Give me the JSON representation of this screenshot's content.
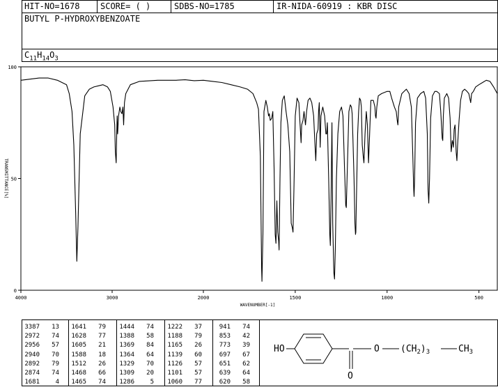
{
  "header": {
    "hit_no": "HIT-NO=1678",
    "score": "SCORE=  (   )",
    "sdbs_no": "SDBS-NO=1785",
    "ir_info": "IR-NIDA-60919 : KBR DISC"
  },
  "compound": {
    "name": "BUTYL P-HYDROXYBENZOATE",
    "formula_parts": [
      {
        "t": "C",
        "sub": false
      },
      {
        "t": "11",
        "sub": true
      },
      {
        "t": "H",
        "sub": false
      },
      {
        "t": "14",
        "sub": true
      },
      {
        "t": "O",
        "sub": false
      },
      {
        "t": "3",
        "sub": true
      }
    ]
  },
  "structure": {
    "ho_label": "HO",
    "o_label": "O",
    "chain_label": "(CH",
    "chain_sub": "2",
    "chain_close": ")",
    "chain_count": "3",
    "end_label": "CH",
    "end_sub": "3",
    "carbonyl_o": "O"
  },
  "chart_data": {
    "type": "line",
    "xlabel": "WAVENUMBER[-1]",
    "ylabel": "TRANSMITTANCE[%]",
    "x_ticks": [
      "4000",
      "3000",
      "2000",
      "1500",
      "1000",
      "500"
    ],
    "x_tick_values": [
      4000,
      3000,
      2000,
      1500,
      1000,
      500
    ],
    "y_ticks": [
      "100",
      "50",
      "0"
    ],
    "y_tick_values": [
      100,
      50,
      0
    ],
    "xlim": [
      4000,
      400
    ],
    "ylim": [
      0,
      100
    ],
    "x_scale": "piecewise (4000-2000 compressed, 2000-400 expanded)",
    "grid": false,
    "series": [
      {
        "values": [
          [
            4000,
            94
          ],
          [
            3900,
            94.5
          ],
          [
            3800,
            95
          ],
          [
            3700,
            95
          ],
          [
            3600,
            94
          ],
          [
            3500,
            92
          ],
          [
            3470,
            88
          ],
          [
            3440,
            80
          ],
          [
            3420,
            65
          ],
          [
            3400,
            35
          ],
          [
            3387,
            13
          ],
          [
            3375,
            28
          ],
          [
            3350,
            70
          ],
          [
            3300,
            87
          ],
          [
            3250,
            90
          ],
          [
            3200,
            91
          ],
          [
            3150,
            91.5
          ],
          [
            3100,
            92
          ],
          [
            3050,
            91
          ],
          [
            3020,
            89
          ],
          [
            2990,
            82
          ],
          [
            2972,
            74
          ],
          [
            2965,
            62
          ],
          [
            2956,
            57
          ],
          [
            2950,
            70
          ],
          [
            2945,
            78
          ],
          [
            2940,
            70
          ],
          [
            2930,
            78
          ],
          [
            2915,
            82
          ],
          [
            2905,
            80
          ],
          [
            2892,
            79
          ],
          [
            2882,
            82
          ],
          [
            2874,
            74
          ],
          [
            2865,
            84
          ],
          [
            2850,
            88
          ],
          [
            2800,
            92
          ],
          [
            2700,
            93.5
          ],
          [
            2500,
            94
          ],
          [
            2300,
            94
          ],
          [
            2200,
            94.2
          ],
          [
            2100,
            93.8
          ],
          [
            2000,
            94
          ],
          [
            1950,
            93.5
          ],
          [
            1900,
            93
          ],
          [
            1850,
            92
          ],
          [
            1800,
            91
          ],
          [
            1760,
            90
          ],
          [
            1730,
            88
          ],
          [
            1710,
            84
          ],
          [
            1700,
            81
          ],
          [
            1690,
            60
          ],
          [
            1683,
            10
          ],
          [
            1681,
            4
          ],
          [
            1676,
            25
          ],
          [
            1670,
            80
          ],
          [
            1660,
            85
          ],
          [
            1652,
            82
          ],
          [
            1645,
            78
          ],
          [
            1641,
            79
          ],
          [
            1636,
            76
          ],
          [
            1628,
            77
          ],
          [
            1622,
            80
          ],
          [
            1615,
            55
          ],
          [
            1609,
            25
          ],
          [
            1605,
            21
          ],
          [
            1600,
            40
          ],
          [
            1595,
            26
          ],
          [
            1590,
            22
          ],
          [
            1588,
            18
          ],
          [
            1583,
            50
          ],
          [
            1578,
            75
          ],
          [
            1570,
            85
          ],
          [
            1560,
            87
          ],
          [
            1550,
            80
          ],
          [
            1540,
            74
          ],
          [
            1530,
            62
          ],
          [
            1522,
            30
          ],
          [
            1516,
            28
          ],
          [
            1512,
            26
          ],
          [
            1507,
            45
          ],
          [
            1500,
            78
          ],
          [
            1490,
            86
          ],
          [
            1480,
            84
          ],
          [
            1475,
            76
          ],
          [
            1468,
            66
          ],
          [
            1465,
            74
          ],
          [
            1458,
            76
          ],
          [
            1452,
            80
          ],
          [
            1444,
            74
          ],
          [
            1438,
            80
          ],
          [
            1430,
            85
          ],
          [
            1420,
            86
          ],
          [
            1410,
            84
          ],
          [
            1400,
            78
          ],
          [
            1393,
            66
          ],
          [
            1388,
            58
          ],
          [
            1383,
            70
          ],
          [
            1376,
            72
          ],
          [
            1373,
            80
          ],
          [
            1369,
            84
          ],
          [
            1366,
            72
          ],
          [
            1364,
            64
          ],
          [
            1360,
            78
          ],
          [
            1350,
            82
          ],
          [
            1340,
            78
          ],
          [
            1333,
            70
          ],
          [
            1329,
            70
          ],
          [
            1325,
            75
          ],
          [
            1318,
            50
          ],
          [
            1312,
            25
          ],
          [
            1309,
            20
          ],
          [
            1305,
            40
          ],
          [
            1300,
            75
          ],
          [
            1296,
            30
          ],
          [
            1290,
            8
          ],
          [
            1286,
            5
          ],
          [
            1282,
            18
          ],
          [
            1276,
            50
          ],
          [
            1268,
            70
          ],
          [
            1258,
            80
          ],
          [
            1248,
            82
          ],
          [
            1240,
            78
          ],
          [
            1232,
            55
          ],
          [
            1225,
            38
          ],
          [
            1222,
            37
          ],
          [
            1218,
            50
          ],
          [
            1208,
            80
          ],
          [
            1200,
            83
          ],
          [
            1194,
            82
          ],
          [
            1190,
            79
          ],
          [
            1186,
            68
          ],
          [
            1180,
            50
          ],
          [
            1175,
            30
          ],
          [
            1172,
            25
          ],
          [
            1170,
            26
          ],
          [
            1168,
            35
          ],
          [
            1160,
            70
          ],
          [
            1155,
            80
          ],
          [
            1150,
            86
          ],
          [
            1144,
            85
          ],
          [
            1140,
            82
          ],
          [
            1135,
            65
          ],
          [
            1130,
            60
          ],
          [
            1126,
            57
          ],
          [
            1120,
            70
          ],
          [
            1113,
            80
          ],
          [
            1107,
            74
          ],
          [
            1101,
            57
          ],
          [
            1095,
            70
          ],
          [
            1088,
            85
          ],
          [
            1075,
            85
          ],
          [
            1066,
            82
          ],
          [
            1063,
            78
          ],
          [
            1060,
            77
          ],
          [
            1056,
            82
          ],
          [
            1048,
            87
          ],
          [
            1030,
            88
          ],
          [
            1000,
            89
          ],
          [
            985,
            89
          ],
          [
            975,
            86
          ],
          [
            960,
            82
          ],
          [
            950,
            80
          ],
          [
            945,
            76
          ],
          [
            941,
            74
          ],
          [
            937,
            82
          ],
          [
            920,
            88
          ],
          [
            895,
            90
          ],
          [
            880,
            88
          ],
          [
            868,
            82
          ],
          [
            860,
            60
          ],
          [
            855,
            45
          ],
          [
            853,
            42
          ],
          [
            850,
            50
          ],
          [
            845,
            75
          ],
          [
            835,
            86
          ],
          [
            818,
            88
          ],
          [
            800,
            89
          ],
          [
            790,
            86
          ],
          [
            781,
            70
          ],
          [
            777,
            45
          ],
          [
            773,
            39
          ],
          [
            769,
            50
          ],
          [
            763,
            77
          ],
          [
            753,
            87
          ],
          [
            740,
            89
          ],
          [
            730,
            89
          ],
          [
            715,
            88
          ],
          [
            708,
            80
          ],
          [
            700,
            68
          ],
          [
            697,
            67
          ],
          [
            694,
            78
          ],
          [
            688,
            86
          ],
          [
            675,
            88
          ],
          [
            665,
            86
          ],
          [
            657,
            77
          ],
          [
            651,
            62
          ],
          [
            645,
            67
          ],
          [
            642,
            66
          ],
          [
            639,
            64
          ],
          [
            635,
            72
          ],
          [
            630,
            74
          ],
          [
            624,
            62
          ],
          [
            620,
            58
          ],
          [
            616,
            65
          ],
          [
            608,
            76
          ],
          [
            600,
            85
          ],
          [
            590,
            89
          ],
          [
            578,
            90
          ],
          [
            565,
            89
          ],
          [
            555,
            88
          ],
          [
            545,
            84
          ],
          [
            540,
            88
          ],
          [
            530,
            89
          ],
          [
            518,
            91
          ],
          [
            500,
            92
          ],
          [
            480,
            93
          ],
          [
            460,
            94
          ],
          [
            440,
            93.5
          ],
          [
            420,
            91
          ],
          [
            400,
            88
          ]
        ]
      }
    ]
  },
  "peaks": {
    "columns": [
      [
        [
          "3387",
          "13"
        ],
        [
          "2972",
          "74"
        ],
        [
          "2956",
          "57"
        ],
        [
          "2940",
          "70"
        ],
        [
          "2892",
          "79"
        ],
        [
          "2874",
          "74"
        ],
        [
          "1681",
          "4"
        ]
      ],
      [
        [
          "1641",
          "79"
        ],
        [
          "1628",
          "77"
        ],
        [
          "1605",
          "21"
        ],
        [
          "1588",
          "18"
        ],
        [
          "1512",
          "26"
        ],
        [
          "1468",
          "66"
        ],
        [
          "1465",
          "74"
        ]
      ],
      [
        [
          "1444",
          "74"
        ],
        [
          "1388",
          "58"
        ],
        [
          "1369",
          "84"
        ],
        [
          "1364",
          "64"
        ],
        [
          "1329",
          "70"
        ],
        [
          "1309",
          "20"
        ],
        [
          "1286",
          "5"
        ]
      ],
      [
        [
          "1222",
          "37"
        ],
        [
          "1188",
          "79"
        ],
        [
          "1165",
          "26"
        ],
        [
          "1139",
          "60"
        ],
        [
          "1126",
          "57"
        ],
        [
          "1101",
          "57"
        ],
        [
          "1060",
          "77"
        ]
      ],
      [
        [
          "941",
          "74"
        ],
        [
          "853",
          "42"
        ],
        [
          "773",
          "39"
        ],
        [
          "697",
          "67"
        ],
        [
          "651",
          "62"
        ],
        [
          "639",
          "64"
        ],
        [
          "620",
          "58"
        ]
      ]
    ]
  }
}
